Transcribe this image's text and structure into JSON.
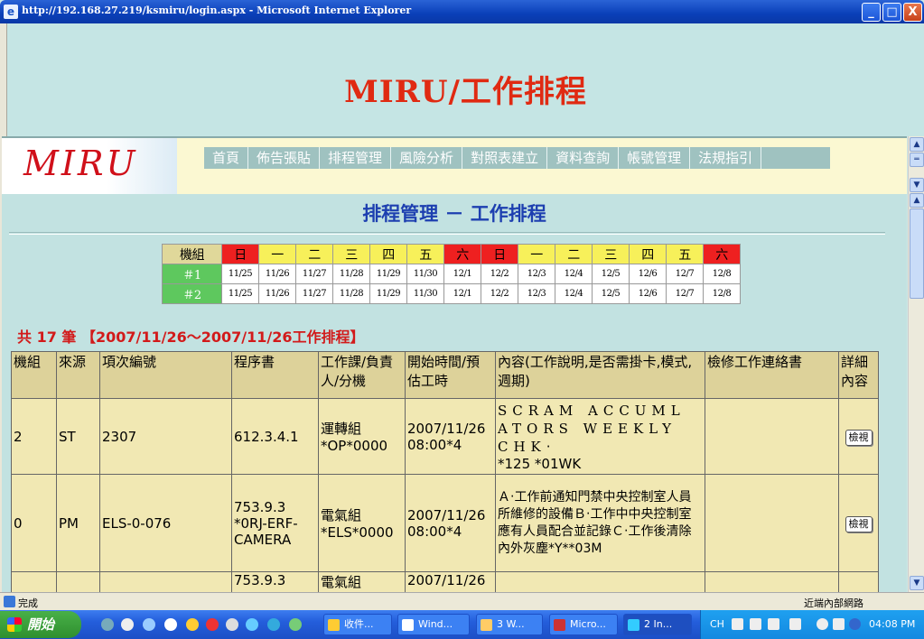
{
  "window": {
    "title": "http://192.168.27.219/ksmiru/login.aspx - Microsoft Internet Explorer",
    "min": "_",
    "max": "□",
    "close": "X"
  },
  "banner": {
    "title": "MIRU/工作排程"
  },
  "logo": "MIRU",
  "nav": [
    "首頁",
    "佈告張貼",
    "排程管理",
    "風險分析",
    "對照表建立",
    "資料查詢",
    "帳號管理",
    "法規指引"
  ],
  "page_title": "排程管理 － 工作排程",
  "calendar": {
    "corner": "機組",
    "days": [
      "日",
      "一",
      "二",
      "三",
      "四",
      "五",
      "六",
      "日",
      "一",
      "二",
      "三",
      "四",
      "五",
      "六"
    ],
    "rows": [
      {
        "unit": "＃1",
        "dates": [
          "11/25",
          "11/26",
          "11/27",
          "11/28",
          "11/29",
          "11/30",
          "12/1",
          "12/2",
          "12/3",
          "12/4",
          "12/5",
          "12/6",
          "12/7",
          "12/8"
        ]
      },
      {
        "unit": "＃2",
        "dates": [
          "11/25",
          "11/26",
          "11/27",
          "11/28",
          "11/29",
          "11/30",
          "12/1",
          "12/2",
          "12/3",
          "12/4",
          "12/5",
          "12/6",
          "12/7",
          "12/8"
        ]
      }
    ]
  },
  "count_line": "共 17 筆 【2007/11/26～2007/11/26工作排程】",
  "table": {
    "headers": [
      "機組",
      "來源",
      "項次編號",
      "程序書",
      "工作課/負責人/分機",
      "開始時間/預估工時",
      "內容(工作說明,是否需掛卡,模式,週期)",
      "檢修工作連絡書",
      "詳細內容"
    ],
    "rows": [
      {
        "unit": "2",
        "source": "ST",
        "item": "2307",
        "proc": "612.3.4.1",
        "dept": "運轉組 *OP*0000",
        "start": "2007/11/26 08:00*4",
        "content_main": "SCRAM ACCUML ATORS WEEKLY CHK‧",
        "content_tail": "*125 *01WK",
        "link": "",
        "detail": "檢視"
      },
      {
        "unit": "0",
        "source": "PM",
        "item": "ELS-0-076",
        "proc": "753.9.3 *0RJ-ERF-CAMERA",
        "dept": "電氣組 *ELS*0000",
        "start": "2007/11/26 08:00*4",
        "content_main": "Ａ‧工作前通知門禁中央控制室人員所維修的設備Ｂ‧工作中中央控制室應有人員配合並記錄Ｃ‧工作後清除內外灰塵*Y**03M",
        "content_tail": "",
        "link": "",
        "detail": "檢視"
      },
      {
        "unit": "",
        "source": "",
        "item": "",
        "proc": "753.9.3",
        "dept": "電氣組",
        "start": "2007/11/26",
        "content_main": "",
        "content_tail": "",
        "link": "",
        "detail": ""
      }
    ]
  },
  "status": {
    "text": "完成",
    "zone": "近端內部網路"
  },
  "taskbar": {
    "start": "開始",
    "tasks": [
      "收件...",
      "Wind...",
      "3 W...",
      "Micro...",
      "2 In..."
    ],
    "lang": "CH",
    "time": "04:08 PM"
  },
  "colors": {
    "red_day": "#ee2020",
    "yellow_day": "#f7f05a",
    "unit_green": "#5ec85e",
    "title_red": "#e02a12"
  }
}
